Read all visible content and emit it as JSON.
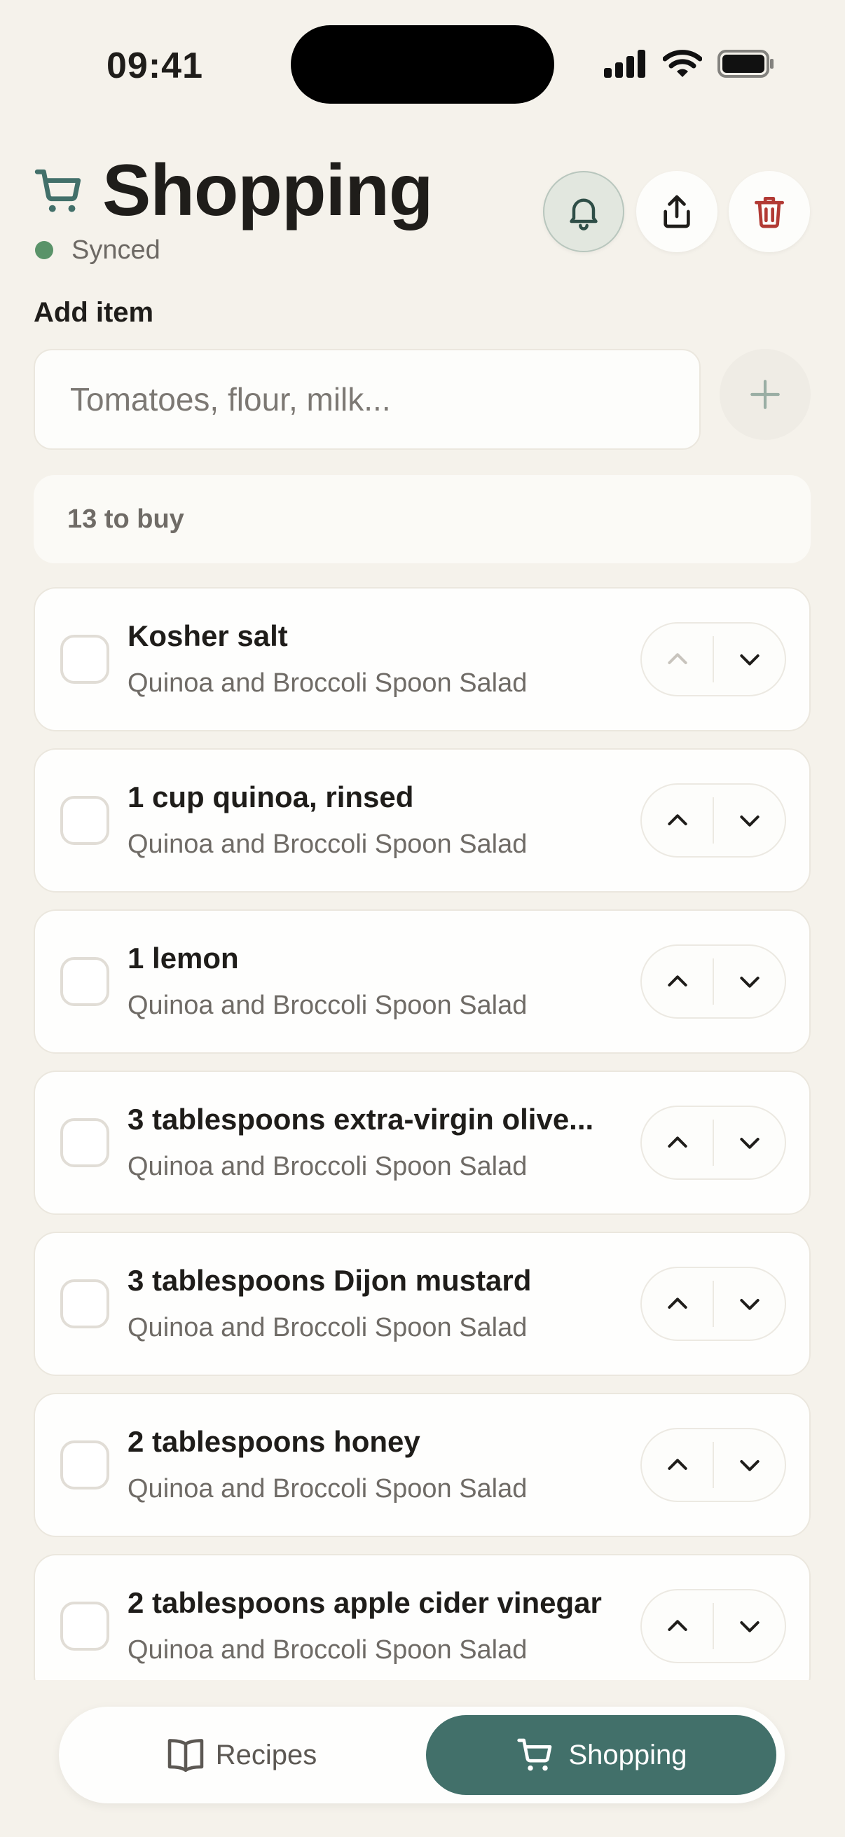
{
  "status_bar": {
    "time": "09:41"
  },
  "header": {
    "title": "Shopping",
    "sync_status": "Synced",
    "icons": {
      "cart": "cart-icon",
      "bell": "bell-icon",
      "share": "share-icon",
      "trash": "trash-icon"
    }
  },
  "add_item": {
    "label": "Add item",
    "placeholder": "Tomatoes, flour, milk...",
    "value": ""
  },
  "summary": {
    "count_text": "13 to buy"
  },
  "items": [
    {
      "name": "Kosher salt",
      "recipe": "Quinoa and Broccoli Spoon Salad",
      "checked": false,
      "up_enabled": false
    },
    {
      "name": "1 cup quinoa, rinsed",
      "recipe": "Quinoa and Broccoli Spoon Salad",
      "checked": false,
      "up_enabled": true
    },
    {
      "name": "1 lemon",
      "recipe": "Quinoa and Broccoli Spoon Salad",
      "checked": false,
      "up_enabled": true
    },
    {
      "name": "3 tablespoons extra-virgin olive...",
      "recipe": "Quinoa and Broccoli Spoon Salad",
      "checked": false,
      "up_enabled": true
    },
    {
      "name": "3 tablespoons Dijon mustard",
      "recipe": "Quinoa and Broccoli Spoon Salad",
      "checked": false,
      "up_enabled": true
    },
    {
      "name": "2 tablespoons honey",
      "recipe": "Quinoa and Broccoli Spoon Salad",
      "checked": false,
      "up_enabled": true
    },
    {
      "name": "2 tablespoons apple cider vinegar",
      "recipe": "Quinoa and Broccoli Spoon Salad",
      "checked": false,
      "up_enabled": true
    }
  ],
  "tabs": [
    {
      "label": "Recipes",
      "icon": "book-icon",
      "active": false
    },
    {
      "label": "Shopping",
      "icon": "cart-icon",
      "active": true
    }
  ],
  "colors": {
    "background": "#f5f2eb",
    "accent": "#42706a",
    "synced": "#5a9369",
    "danger": "#b23a34"
  }
}
